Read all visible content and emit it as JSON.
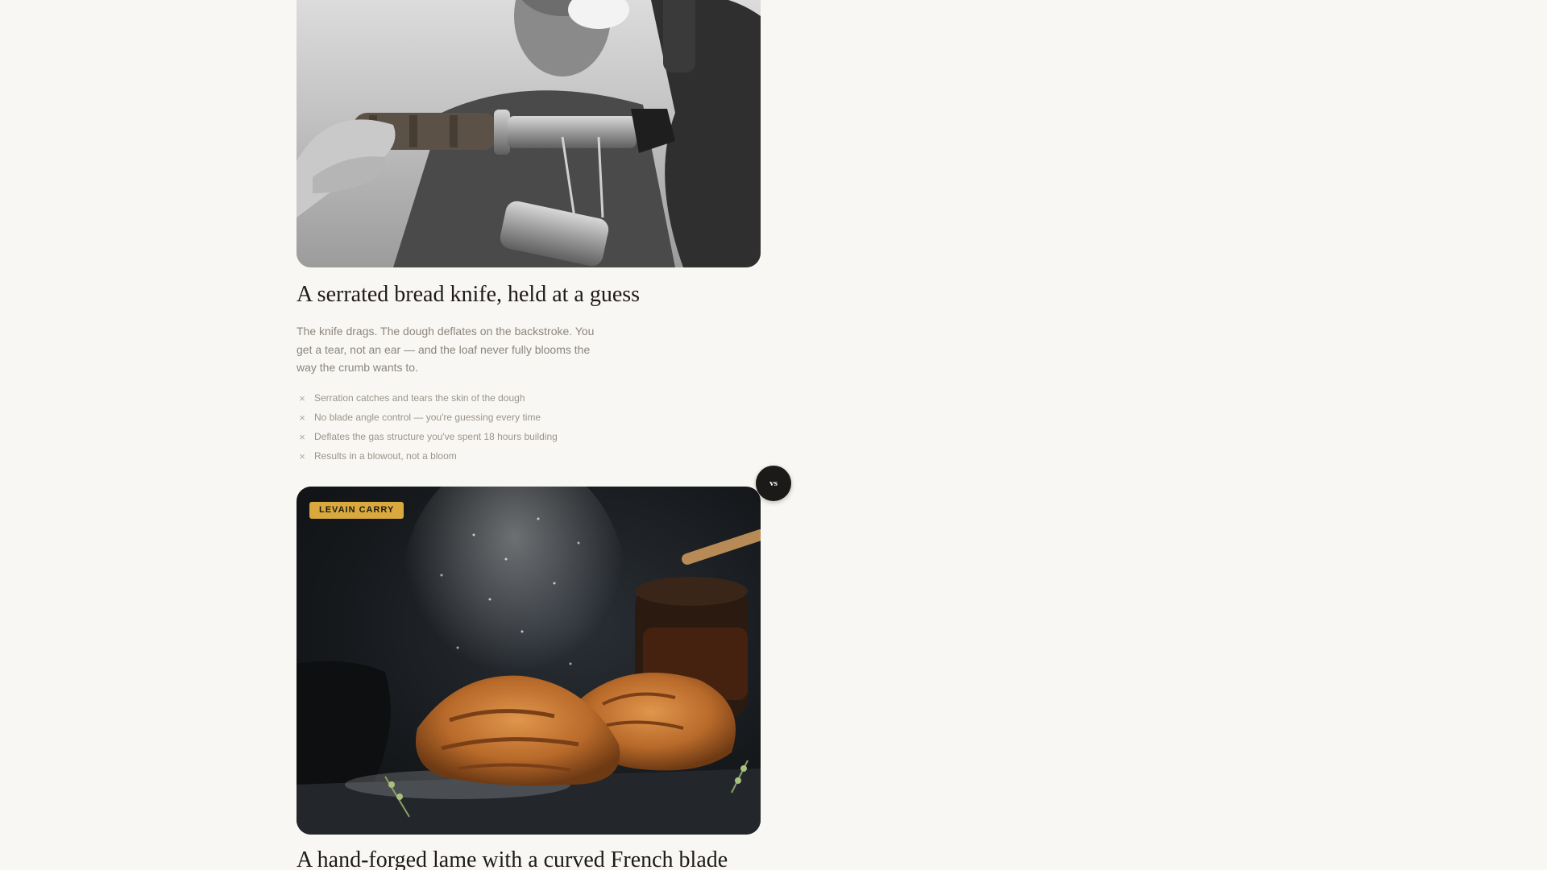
{
  "serrated_card": {
    "title": "A serrated bread knife, held at a guess",
    "description": "The knife drags. The dough deflates on the backstroke. You get a tear, not an ear — and the loaf never fully blooms the way the crumb wants to.",
    "cons": [
      "Serration catches and tears the skin of the dough",
      "No blade angle control — you're guessing every time",
      "Deflates the gas structure you've spent 18 hours building",
      "Results in a blowout, not a bloom"
    ],
    "con_icon": "×"
  },
  "versus": {
    "label": "vs"
  },
  "lame_card": {
    "badge": "LEVAIN CARRY",
    "title": "A hand-forged lame with a curved French blade"
  },
  "colors": {
    "background": "#f9f7f3",
    "heading": "#1e1a17",
    "body_text": "#8c857e",
    "badge": "#d9a93e",
    "vs_badge": "#1c1a18"
  }
}
